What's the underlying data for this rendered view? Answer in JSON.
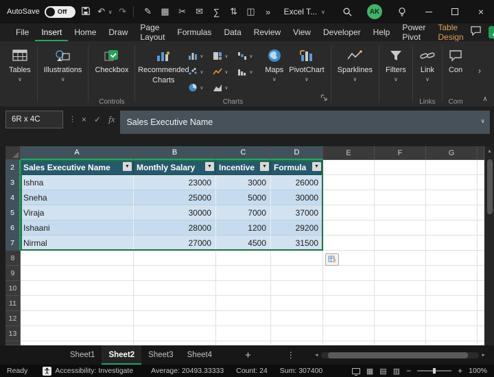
{
  "titlebar": {
    "autosave_label": "AutoSave",
    "autosave_state": "Off",
    "app_title": "Excel T...",
    "avatar": "AK"
  },
  "tabs": {
    "items": [
      "File",
      "Insert",
      "Home",
      "Draw",
      "Page Layout",
      "Formulas",
      "Data",
      "Review",
      "View",
      "Developer",
      "Help",
      "Power Pivot",
      "Table Design"
    ],
    "active": "Insert"
  },
  "ribbon": {
    "tables": "Tables",
    "illustrations": "Illustrations",
    "checkbox": "Checkbox",
    "recommended_line1": "Recommended",
    "recommended_line2": "Charts",
    "maps": "Maps",
    "pivotchart": "PivotChart",
    "sparklines": "Sparklines",
    "filters": "Filters",
    "link": "Link",
    "comments_truncated": "Con",
    "groups": {
      "controls": "Controls",
      "charts": "Charts",
      "links": "Links",
      "comments_truncated": "Com"
    }
  },
  "formula_bar": {
    "name_box": "6R x 4C",
    "fx_label": "fx",
    "content": "Sales Executive Name"
  },
  "grid": {
    "columns": [
      "A",
      "B",
      "C",
      "D",
      "E",
      "F",
      "G"
    ],
    "selected_columns": [
      "A",
      "B",
      "C",
      "D"
    ],
    "row_numbers": [
      "2",
      "3",
      "4",
      "5",
      "6",
      "7",
      "8",
      "9",
      "10",
      "11",
      "12",
      "13"
    ],
    "selected_rows": [
      "2",
      "3",
      "4",
      "5",
      "6",
      "7"
    ],
    "table": {
      "headers": [
        "Sales Executive Name",
        "Monthly Salary",
        "Incentive",
        "Formula"
      ],
      "rows": [
        [
          "Ishna",
          "23000",
          "3000",
          "26000"
        ],
        [
          "Sneha",
          "25000",
          "5000",
          "30000"
        ],
        [
          "Viraja",
          "30000",
          "7000",
          "37000"
        ],
        [
          "Ishaani",
          "28000",
          "1200",
          "29200"
        ],
        [
          "Nirmal",
          "27000",
          "4500",
          "31500"
        ]
      ]
    }
  },
  "sheets": {
    "tabs": [
      "Sheet1",
      "Sheet2",
      "Sheet3",
      "Sheet4"
    ],
    "active": "Sheet2"
  },
  "status": {
    "mode": "Ready",
    "accessibility": "Accessibility: Investigate",
    "average": "Average: 20493.33333",
    "count": "Count: 24",
    "sum": "Sum: 307400",
    "zoom": "100%"
  },
  "icons": {
    "undo": "↶",
    "redo": "↷",
    "qat": [
      "✎",
      "▦",
      "✂",
      "✉",
      "∑",
      "⇅",
      "◫"
    ],
    "overflow": "»",
    "chevron_down": "∨",
    "chevron_up": "∧",
    "more_vertical": "⋮",
    "cancel": "×",
    "check": "✓",
    "filter": "▼",
    "up": "▲",
    "down": "▼",
    "left": "◄",
    "right": "►",
    "plus": "+",
    "minus": "−",
    "scroll_right": "›",
    "grid_view": "▦",
    "page_layout_view": "▤",
    "page_break_view": "▥",
    "close": "×"
  },
  "colors": {
    "excel_green": "#26a466",
    "table_header_teal": "#26596b",
    "contextual_tab_gold": "#d8a255",
    "selection_fill": "#cde0ef",
    "titlebar_bg": "#141414"
  }
}
